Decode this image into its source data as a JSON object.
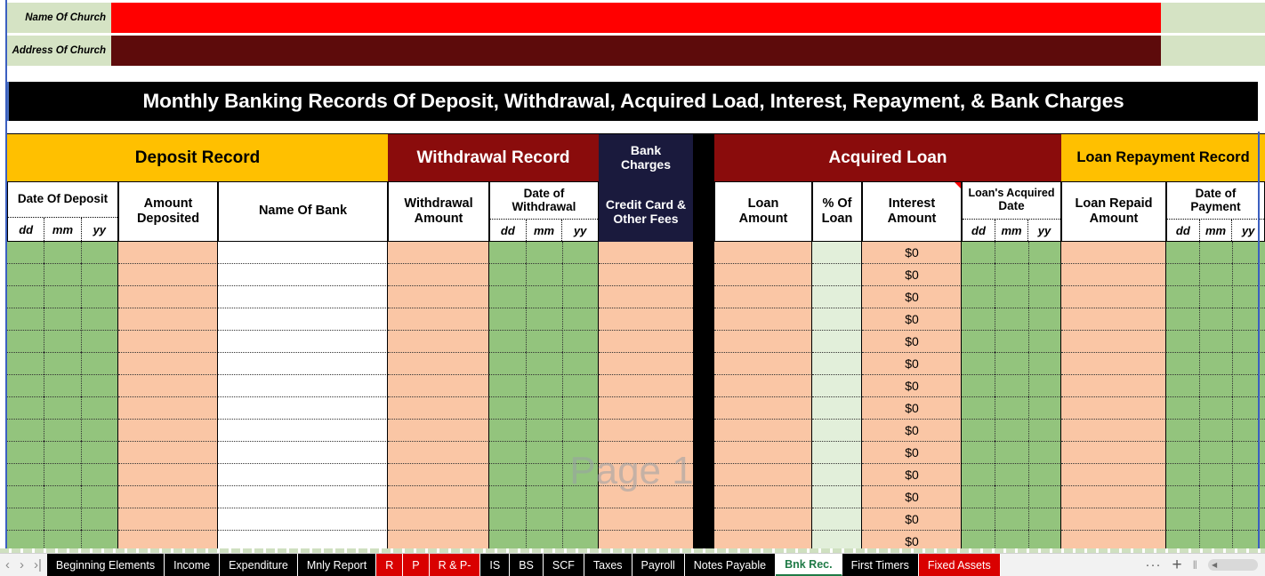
{
  "church": {
    "name_label": "Name Of Church",
    "address_label": "Address Of Church",
    "name_value": "",
    "address_value": "",
    "name_fill": "#ff0000",
    "address_fill": "#5d0b0b",
    "label_fill": "#d5e3c4"
  },
  "title": "Monthly Banking Records Of Deposit, Withdrawal, Acquired Load, Interest, Repayment, & Bank Charges",
  "watermark": "Page 1",
  "groups": {
    "deposit": "Deposit Record",
    "withdrawal": "Withdrawal Record",
    "bank_charges": "Bank\nCharges",
    "bank_charges_l1": "Bank",
    "bank_charges_l2": "Charges",
    "acquired_loan": "Acquired Loan",
    "loan_repayment": "Loan Repayment Record"
  },
  "headers": {
    "date_of_deposit": "Date Of Deposit",
    "amount_deposited": "Amount\nDeposited",
    "amount_deposited_l1": "Amount",
    "amount_deposited_l2": "Deposited",
    "name_of_bank": "Name Of Bank",
    "withdrawal_amount_l1": "Withdrawal",
    "withdrawal_amount_l2": "Amount",
    "date_of_withdrawal_l1": "Date of",
    "date_of_withdrawal_l2": "Withdrawal",
    "credit_card_l1": "Credit Card &",
    "credit_card_l2": "Other Fees",
    "loan_amount_l1": "Loan",
    "loan_amount_l2": "Amount",
    "pct_of_loan_l1": "% Of",
    "pct_of_loan_l2": "Loan",
    "interest_amount_l1": "Interest",
    "interest_amount_l2": "Amount",
    "loans_acquired_date_l1": "Loan's Acquired",
    "loans_acquired_date_l2": "Date",
    "loan_repaid_l1": "Loan Repaid",
    "loan_repaid_l2": "Amount",
    "date_of_payment_l1": "Date of",
    "date_of_payment_l2": "Payment",
    "dd": "dd",
    "mm": "mm",
    "yy": "yy"
  },
  "rows": {
    "count": 14,
    "deposit_dd": [
      "",
      "",
      "",
      "",
      "",
      "",
      "",
      "",
      "",
      "",
      "",
      "",
      "",
      ""
    ],
    "deposit_mm": [
      "",
      "",
      "",
      "",
      "",
      "",
      "",
      "",
      "",
      "",
      "",
      "",
      "",
      ""
    ],
    "deposit_yy": [
      "",
      "",
      "",
      "",
      "",
      "",
      "",
      "",
      "",
      "",
      "",
      "",
      "",
      ""
    ],
    "amount_deposited": [
      "",
      "",
      "",
      "",
      "",
      "",
      "",
      "",
      "",
      "",
      "",
      "",
      "",
      ""
    ],
    "name_of_bank": [
      "",
      "",
      "",
      "",
      "",
      "",
      "",
      "",
      "",
      "",
      "",
      "",
      "",
      ""
    ],
    "withdrawal_amount": [
      "",
      "",
      "",
      "",
      "",
      "",
      "",
      "",
      "",
      "",
      "",
      "",
      "",
      ""
    ],
    "withdrawal_dd": [
      "",
      "",
      "",
      "",
      "",
      "",
      "",
      "",
      "",
      "",
      "",
      "",
      "",
      ""
    ],
    "withdrawal_mm": [
      "",
      "",
      "",
      "",
      "",
      "",
      "",
      "",
      "",
      "",
      "",
      "",
      "",
      ""
    ],
    "withdrawal_yy": [
      "",
      "",
      "",
      "",
      "",
      "",
      "",
      "",
      "",
      "",
      "",
      "",
      "",
      ""
    ],
    "credit_card_fees": [
      "",
      "",
      "",
      "",
      "",
      "",
      "",
      "",
      "",
      "",
      "",
      "",
      "",
      ""
    ],
    "loan_amount": [
      "",
      "",
      "",
      "",
      "",
      "",
      "",
      "",
      "",
      "",
      "",
      "",
      "",
      ""
    ],
    "pct_of_loan": [
      "",
      "",
      "",
      "",
      "",
      "",
      "",
      "",
      "",
      "",
      "",
      "",
      "",
      ""
    ],
    "interest_amount": [
      "$0",
      "$0",
      "$0",
      "$0",
      "$0",
      "$0",
      "$0",
      "$0",
      "$0",
      "$0",
      "$0",
      "$0",
      "$0",
      "$0"
    ],
    "loan_acq_dd": [
      "",
      "",
      "",
      "",
      "",
      "",
      "",
      "",
      "",
      "",
      "",
      "",
      "",
      ""
    ],
    "loan_acq_mm": [
      "",
      "",
      "",
      "",
      "",
      "",
      "",
      "",
      "",
      "",
      "",
      "",
      "",
      ""
    ],
    "loan_acq_yy": [
      "",
      "",
      "",
      "",
      "",
      "",
      "",
      "",
      "",
      "",
      "",
      "",
      "",
      ""
    ],
    "loan_repaid_amount": [
      "",
      "",
      "",
      "",
      "",
      "",
      "",
      "",
      "",
      "",
      "",
      "",
      "",
      ""
    ],
    "payment_dd": [
      "",
      "",
      "",
      "",
      "",
      "",
      "",
      "",
      "",
      "",
      "",
      "",
      "",
      ""
    ],
    "payment_mm": [
      "",
      "",
      "",
      "",
      "",
      "",
      "",
      "",
      "",
      "",
      "",
      "",
      "",
      ""
    ],
    "payment_yy": [
      "",
      "",
      "",
      "",
      "",
      "",
      "",
      "",
      "",
      "",
      "",
      "",
      "",
      ""
    ]
  },
  "colors": {
    "gold": "#ffc000",
    "dark_red": "#8a0c0c",
    "navy": "#1a1a3d",
    "green_cell": "#93c47d",
    "peach_cell": "#fac6a5",
    "pale_green_cell": "#e2efda",
    "black": "#000000",
    "page_break_blue": "#3b5fc0",
    "active_tab_text": "#1f7a46",
    "red_tab": "#d90000"
  },
  "tabbar": {
    "nav": {
      "first": "‹",
      "prev": "›",
      "next": "›|"
    },
    "tabs": [
      {
        "label": "Beginning Elements",
        "style": "black",
        "active": false
      },
      {
        "label": "Income",
        "style": "black",
        "active": false
      },
      {
        "label": "Expenditure",
        "style": "black",
        "active": false
      },
      {
        "label": "Mnly Report",
        "style": "black",
        "active": false
      },
      {
        "label": "R",
        "style": "red",
        "active": false
      },
      {
        "label": "P",
        "style": "red",
        "active": false
      },
      {
        "label": "R & P-",
        "style": "red",
        "active": false
      },
      {
        "label": "IS",
        "style": "black",
        "active": false
      },
      {
        "label": "BS",
        "style": "black",
        "active": false
      },
      {
        "label": "SCF",
        "style": "black",
        "active": false
      },
      {
        "label": "Taxes",
        "style": "black",
        "active": false
      },
      {
        "label": "Payroll",
        "style": "black",
        "active": false
      },
      {
        "label": "Notes Payable",
        "style": "black",
        "active": false
      },
      {
        "label": "Bnk Rec.",
        "style": "active",
        "active": true
      },
      {
        "label": "First Timers",
        "style": "black",
        "active": false
      },
      {
        "label": "Fixed Assets",
        "style": "red",
        "active": false
      }
    ],
    "more": "···",
    "add": "+",
    "grip": "‖",
    "scroll_left": "◀"
  }
}
